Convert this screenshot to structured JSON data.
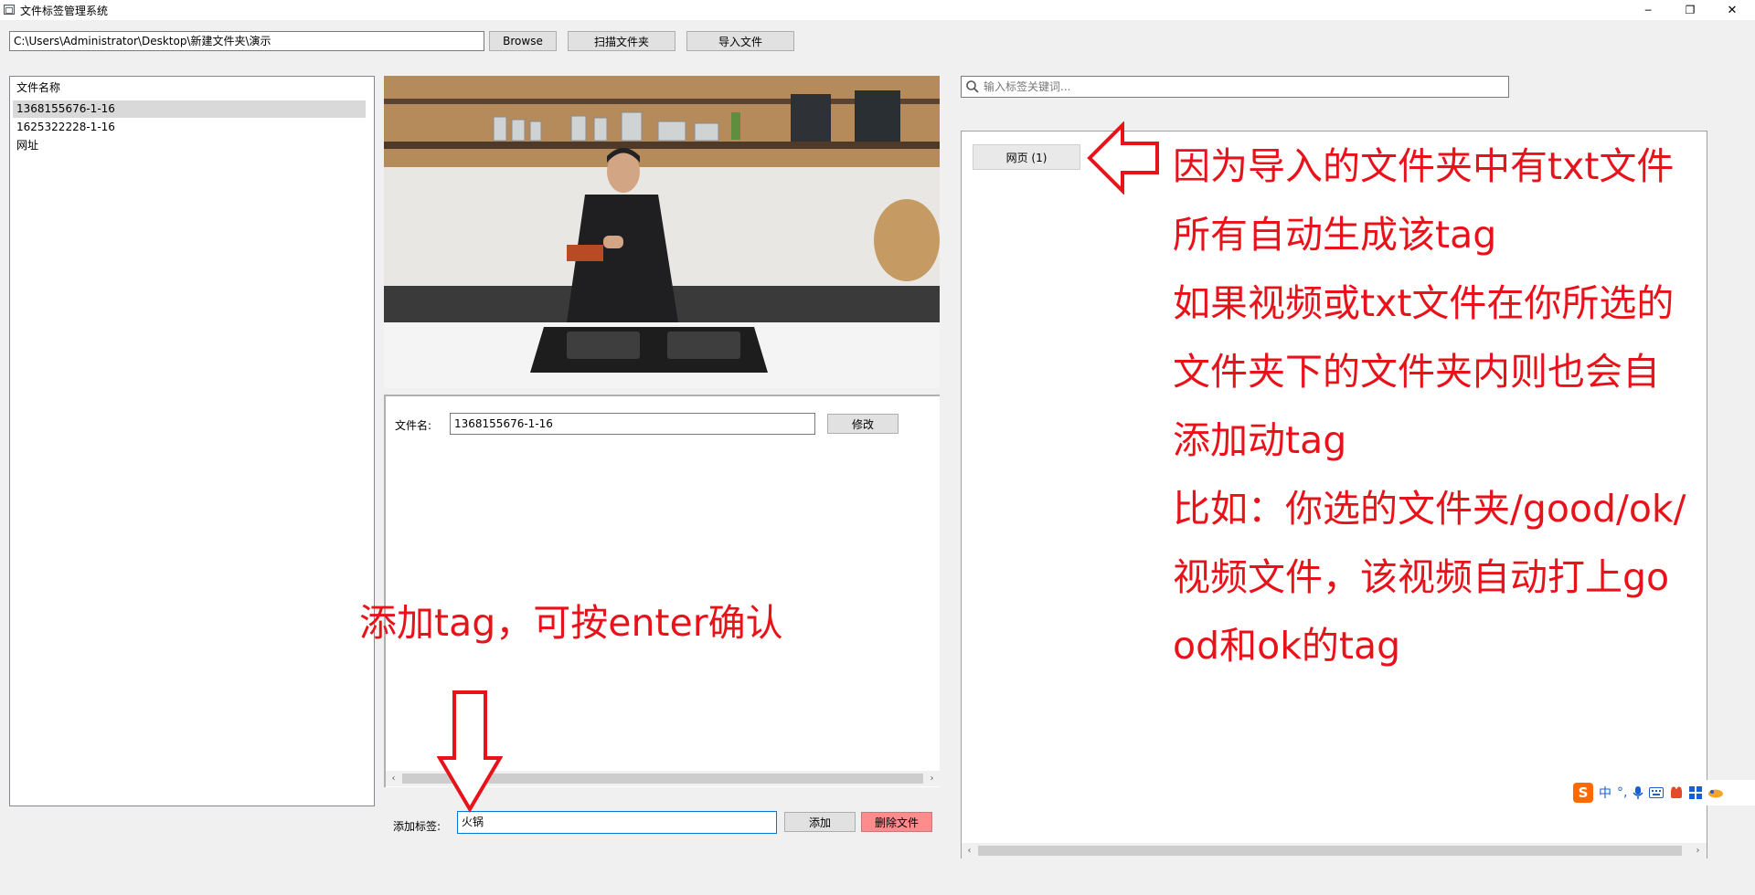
{
  "window": {
    "title": "文件标签管理系统",
    "controls": {
      "minimize": "─",
      "restore": "❐",
      "close": "✕"
    }
  },
  "toolbar": {
    "path_value": "C:\\Users\\Administrator\\Desktop\\新建文件夹\\演示",
    "browse_label": "Browse",
    "scan_label": "扫描文件夹",
    "import_label": "导入文件"
  },
  "file_list": {
    "header": "文件名称",
    "items": [
      "1368155676-1-16",
      "1625322228-1-16",
      "网址"
    ],
    "selected_index": 0
  },
  "details": {
    "filename_label": "文件名:",
    "filename_value": "1368155676-1-16",
    "modify_label": "修改"
  },
  "add_tag": {
    "label": "添加标签:",
    "value": "火锅",
    "add_label": "添加",
    "delete_label": "删除文件"
  },
  "tag_panel": {
    "search_placeholder": "输入标签关键词...",
    "tags": [
      "网页 (1)"
    ]
  },
  "annotations": {
    "add_tag_hint": "添加tag，可按enter确认",
    "auto_tag_lines": [
      "因为导入的文件夹中有txt文件",
      "所有自动生成该tag",
      "如果视频或txt文件在你所选的",
      "文件夹下的文件夹内则也会自",
      "添加动tag",
      "比如：你选的文件夹/good/ok/",
      "视频文件，该视频自动打上go",
      "od和ok的tag"
    ]
  },
  "ime": {
    "logo": "S",
    "mode": "中",
    "punct": "°,"
  },
  "colors": {
    "annotation_red": "#e8131a",
    "delete_button_bg": "#ff8c8c",
    "selected_row_bg": "#d9d9d9",
    "ime_logo": "#ff6a00"
  }
}
